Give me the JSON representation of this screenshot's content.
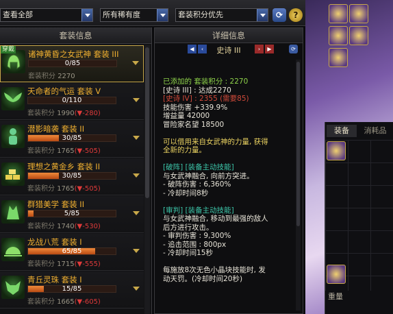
{
  "filters": {
    "category": "查看全部",
    "rarity": "所有稀有度",
    "sort": "套装积分优先",
    "help_label": "?"
  },
  "list_panel": {
    "header": "套装信息",
    "items": [
      {
        "wear_label": "穿戴",
        "name": "诸神黄昏之女武神",
        "set_tier": "套装 III",
        "progress_text": "0/85",
        "progress": 0.0,
        "score_label": "套装积分",
        "score": "2270",
        "delta": ""
      },
      {
        "name": "天命者的气运",
        "set_tier": "套装 V",
        "progress_text": "0/110",
        "progress": 0.0,
        "score_label": "套装积分",
        "score": "1990",
        "delta": "(▼-280)"
      },
      {
        "name": "潜影暗袭",
        "set_tier": "套装 II",
        "progress_text": "30/85",
        "progress": 0.353,
        "score_label": "套装积分",
        "score": "1765",
        "delta": "(▼-505)"
      },
      {
        "name": "理想之黄金乡",
        "set_tier": "套装 II",
        "progress_text": "30/85",
        "progress": 0.353,
        "score_label": "套装积分",
        "score": "1765",
        "delta": "(▼-505)"
      },
      {
        "name": "群猎美学",
        "set_tier": "套装 II",
        "progress_text": "5/85",
        "progress": 0.059,
        "score_label": "套装积分",
        "score": "1740",
        "delta": "(▼-530)"
      },
      {
        "name": "龙战八荒",
        "set_tier": "套装 I",
        "progress_text": "65/85",
        "progress": 0.765,
        "score_label": "套装积分",
        "score": "1715",
        "delta": "(▼-555)"
      },
      {
        "name": "青丘灵珠",
        "set_tier": "套装 I",
        "progress_text": "15/85",
        "progress": 0.176,
        "score_label": "套装积分",
        "score": "1665",
        "delta": "(▼-605)"
      }
    ]
  },
  "detail_panel": {
    "header": "详细信息",
    "tier_title": "史诗 III",
    "lines": [
      {
        "text": "已添加的 套装积分 : 2270",
        "color": "green"
      },
      {
        "text": "[史诗 III] : 达成2270",
        "color": "white"
      },
      {
        "text": "[史诗 IV] : 2355 (需要85)",
        "color": "red"
      },
      {
        "text": "技能伤害 +339.9%",
        "color": "white"
      },
      {
        "text": "增益量 42000",
        "color": "white"
      },
      {
        "text": "冒险家名望 18500",
        "color": "white"
      },
      {
        "text": "",
        "color": "white"
      },
      {
        "text": "可以借用来自女武神的力量, 获得",
        "color": "yellow"
      },
      {
        "text": "全新的力量。",
        "color": "yellow"
      },
      {
        "text": "",
        "color": "white"
      },
      {
        "text": "[破阵] [装备主动技能]",
        "color": "teal"
      },
      {
        "text": "与女武神融合, 向前方突进。",
        "color": "white"
      },
      {
        "text": "- 破阵伤害 : 6,360%",
        "color": "white"
      },
      {
        "text": "- 冷却时间8秒",
        "color": "white"
      },
      {
        "text": "",
        "color": "white"
      },
      {
        "text": "[审判] [装备主动技能]",
        "color": "teal"
      },
      {
        "text": "与女武神融合, 移动到最强的敌人",
        "color": "white"
      },
      {
        "text": "后方进行攻击。",
        "color": "white"
      },
      {
        "text": "- 审判伤害 : 9,300%",
        "color": "white"
      },
      {
        "text": "- 追击范围 : 800px",
        "color": "white"
      },
      {
        "text": "- 冷却时间15秒",
        "color": "white"
      },
      {
        "text": "",
        "color": "white"
      },
      {
        "text": "每施放8次无色小晶块技能时, 发",
        "color": "white"
      },
      {
        "text": "动天罚。(冷却时间20秒)",
        "color": "white"
      }
    ]
  },
  "inventory": {
    "tabs": [
      "装备",
      "消耗品"
    ],
    "weight_label": "重量"
  },
  "colors": {
    "accent_gold": "#c8a84a",
    "set_name": "#f0b030",
    "negative": "#e03a3a",
    "positive_green": "#8ed24a"
  }
}
